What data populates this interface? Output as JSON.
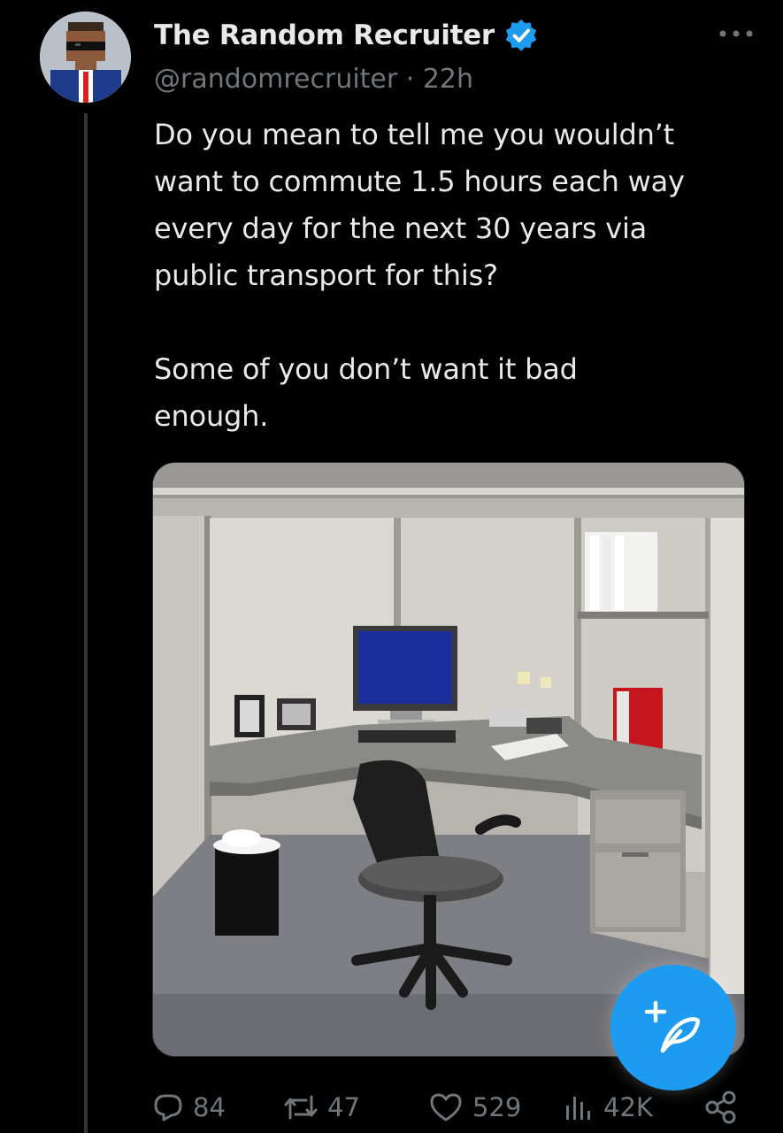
{
  "tweet": {
    "author": {
      "display_name": "The Random Recruiter",
      "handle": "@randomrecruiter",
      "time": "22h",
      "verified": true
    },
    "text": "Do you mean to tell me you wouldn’t\nwant to commute 1.5 hours each way\nevery day for the next 30 years via\npublic transport for this?\n\nSome of you don’t want it bad\nenough.",
    "media": {
      "icon": "office-cubicle-photo"
    },
    "stats": {
      "replies": "84",
      "reposts": "47",
      "likes": "529",
      "views": "42K"
    }
  },
  "icons": {
    "more": "more-dots-icon",
    "reply": "reply-icon",
    "repost": "repost-icon",
    "like": "heart-icon",
    "views": "views-bar-chart-icon",
    "share": "share-icon",
    "compose": "compose-feather-icon",
    "verified": "verified-badge-icon"
  },
  "colors": {
    "background": "#000000",
    "text": "#e7e9ea",
    "muted": "#71767b",
    "accent": "#1d9bf0"
  }
}
